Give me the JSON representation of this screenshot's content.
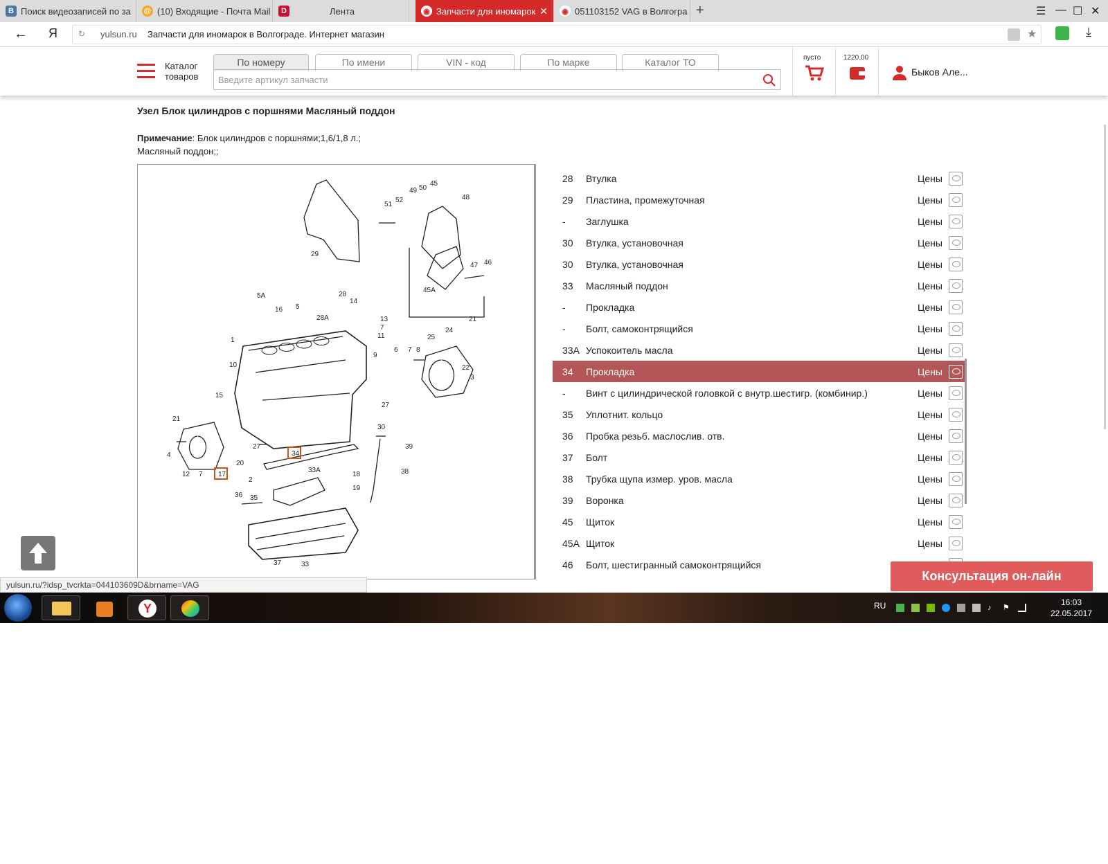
{
  "browser": {
    "tabs": [
      {
        "label": "Поиск видеозаписей по за",
        "icon": "vk-icon"
      },
      {
        "label": "(10) Входящие - Почта Mail",
        "icon": "mail-icon"
      },
      {
        "label": "Лента",
        "icon": "d-icon"
      },
      {
        "label": "Запчасти для иномарок",
        "icon": "yulsun-icon",
        "active": true
      },
      {
        "label": "051103152 VAG в Волгогра",
        "icon": "yulsun-icon"
      }
    ],
    "domain": "yulsun.ru",
    "page_title": "Запчасти для иномарок в Волгограде. Интернет магазин",
    "status_url": "yulsun.ru/?idsp_tvcrkta=044103609D&brname=VAG"
  },
  "header": {
    "catalog_label_1": "Каталог",
    "catalog_label_2": "товаров",
    "search_tabs": [
      "По номеру",
      "По имени",
      "VIN - код",
      "По марке",
      "Каталог ТО"
    ],
    "search_placeholder": "Введите артикул запчасти",
    "cart_label": "пусто",
    "wallet_amount": "1220.00",
    "user_name": "Быков Але..."
  },
  "content": {
    "title": "Узел Блок цилиндров с поршнями Масляный поддон",
    "note_label": "Примечание",
    "note_text": ": Блок цилиндров с поршнями;1,6/1,8 л.;",
    "note_text2": "Масляный поддон;;",
    "prices_label": "Цены",
    "parts": [
      {
        "num": "28",
        "name": "Втулка"
      },
      {
        "num": "29",
        "name": "Пластина, промежуточная"
      },
      {
        "num": "-",
        "name": "Заглушка"
      },
      {
        "num": "30",
        "name": "Втулка, установочная"
      },
      {
        "num": "30",
        "name": "Втулка, установочная"
      },
      {
        "num": "33",
        "name": "Масляный поддон"
      },
      {
        "num": "-",
        "name": "Прокладка"
      },
      {
        "num": "-",
        "name": "Болт, самоконтрящийся"
      },
      {
        "num": "33A",
        "name": "Успокоитель масла"
      },
      {
        "num": "34",
        "name": "Прокладка",
        "highlighted": true
      },
      {
        "num": "-",
        "name": "Винт с цилиндрической головкой с внутр.шестигр. (комбинир.)"
      },
      {
        "num": "35",
        "name": "Уплотнит. кольцо"
      },
      {
        "num": "36",
        "name": "Пробка резьб. маслослив. отв."
      },
      {
        "num": "37",
        "name": "Болт"
      },
      {
        "num": "38",
        "name": "Трубка щупа измер. уров. масла"
      },
      {
        "num": "39",
        "name": "Воронка"
      },
      {
        "num": "45",
        "name": "Щиток"
      },
      {
        "num": "45A",
        "name": "Щиток"
      },
      {
        "num": "46",
        "name": "Болт, шестигранный самоконтрящийся"
      }
    ],
    "consult_label": "Консультация он-лайн"
  },
  "diagram": {
    "callouts": [
      "29",
      "51",
      "52",
      "49",
      "50",
      "45",
      "48",
      "47",
      "46",
      "45A",
      "5A",
      "16",
      "5",
      "28",
      "14",
      "28A",
      "13",
      "7",
      "11",
      "1",
      "10",
      "9",
      "6",
      "7",
      "8",
      "25",
      "24",
      "21",
      "15",
      "22",
      "3",
      "27",
      "21",
      "4",
      "12",
      "7",
      "17",
      "20",
      "27",
      "34",
      "30",
      "39",
      "33A",
      "18",
      "2",
      "38",
      "19",
      "36",
      "35",
      "37",
      "33"
    ],
    "highlight": [
      "34",
      "17"
    ]
  },
  "taskbar": {
    "lang": "RU",
    "time": "16:03",
    "date": "22.05.2017"
  },
  "colors": {
    "brand": "#d42a2a",
    "highlight_row": "#b25657",
    "consult_btn": "#e05b5b"
  }
}
